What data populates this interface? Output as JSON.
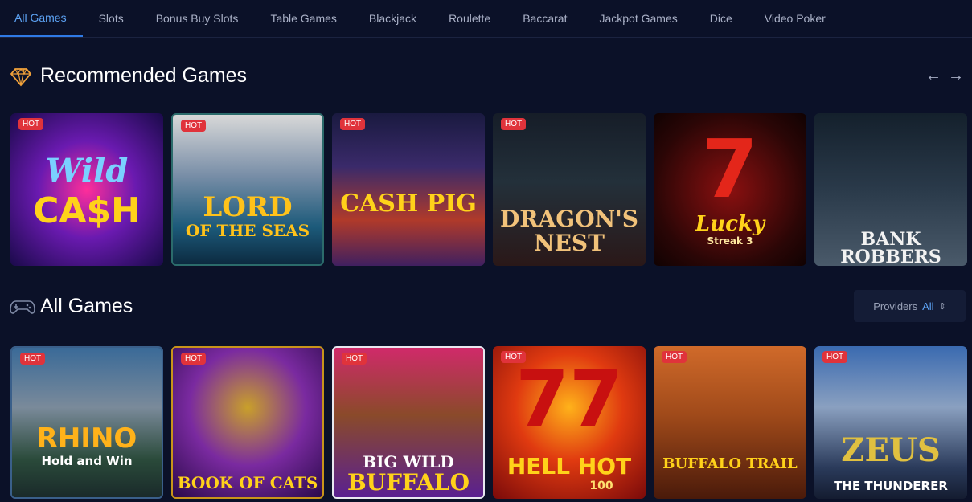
{
  "tabs": [
    {
      "label": "All Games",
      "active": true
    },
    {
      "label": "Slots"
    },
    {
      "label": "Bonus Buy Slots"
    },
    {
      "label": "Table Games"
    },
    {
      "label": "Blackjack"
    },
    {
      "label": "Roulette"
    },
    {
      "label": "Baccarat"
    },
    {
      "label": "Jackpot Games"
    },
    {
      "label": "Dice"
    },
    {
      "label": "Video Poker"
    }
  ],
  "recommended": {
    "title": "Recommended Games",
    "icon": "diamond-icon",
    "nav": {
      "prev": "←",
      "next": "→"
    },
    "games": [
      {
        "badge": "HOT",
        "name1": "Wild",
        "name2": "CA$H",
        "colors": [
          "#3a1a8a",
          "#c2177a"
        ]
      },
      {
        "badge": "HOT",
        "name1": "Lord",
        "name2": "of the Seas",
        "colors": [
          "#1c5a8a",
          "#0c2a40"
        ]
      },
      {
        "badge": "HOT",
        "name1": "Cash Pig",
        "name2": "",
        "colors": [
          "#2a2a55",
          "#a33a2a"
        ]
      },
      {
        "badge": "HOT",
        "name1": "Dragon's",
        "name2": "Nest",
        "colors": [
          "#1b2430",
          "#3a1414"
        ]
      },
      {
        "badge": "",
        "name1": "Lucky",
        "name2": "Streak 3",
        "colors": [
          "#180808",
          "#7a1010"
        ]
      },
      {
        "badge": "",
        "name1": "Bank Robbers",
        "name2": "",
        "colors": [
          "#1c2a3a",
          "#3a4a5a"
        ]
      }
    ]
  },
  "all_games": {
    "title": "All Games",
    "icon": "gamepad-icon",
    "providers_label": "Providers",
    "providers_value": "All",
    "games": [
      {
        "badge": "HOT",
        "name1": "Rhino",
        "name2": "Hold and Win",
        "colors": [
          "#3f6a98",
          "#1a3a2a"
        ]
      },
      {
        "badge": "HOT",
        "name1": "Book of Cats",
        "name2": "",
        "colors": [
          "#6a2a8a",
          "#c9941a"
        ]
      },
      {
        "badge": "HOT",
        "name1": "Big Wild",
        "name2": "Buffalo",
        "colors": [
          "#c0306a",
          "#5a2090"
        ]
      },
      {
        "badge": "HOT",
        "name1": "Hell Hot",
        "name2": "100",
        "colors": [
          "#d42a10",
          "#8a0a0a"
        ]
      },
      {
        "badge": "HOT",
        "name1": "Buffalo Trail",
        "name2": "",
        "colors": [
          "#c8601a",
          "#5a2a10"
        ]
      },
      {
        "badge": "HOT",
        "name1": "Zeus",
        "name2": "The Thunderer",
        "colors": [
          "#3a6aa8",
          "#1a2a4a"
        ]
      }
    ]
  }
}
